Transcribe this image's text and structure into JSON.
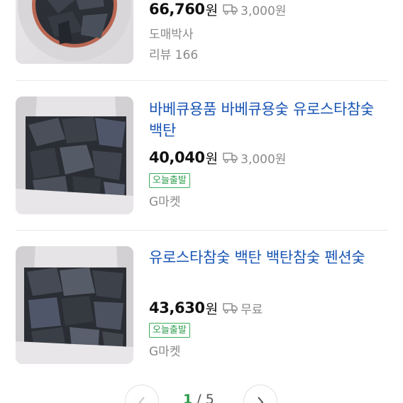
{
  "products": [
    {
      "title": "",
      "price": "66,760",
      "currency": "원",
      "shipping": "3,000원",
      "seller": "도매박사",
      "review": "리뷰 166"
    },
    {
      "title": "바베큐용품 바베큐용숯 유로스타참숯 백탄",
      "price": "40,040",
      "currency": "원",
      "shipping": "3,000원",
      "badge": "오늘출발",
      "seller": "G마켓"
    },
    {
      "title": "유로스타참숯 백탄 백탄참숯 펜션숯",
      "price": "43,630",
      "currency": "원",
      "shipping": "무료",
      "badge": "오늘출발",
      "seller": "G마켓"
    }
  ],
  "pagination": {
    "current": "1",
    "separator": "/",
    "total": "5"
  },
  "colors": {
    "title": "#1a56b4",
    "badge": "#2e9e4f",
    "muted": "#8a8a8a"
  },
  "icons": {
    "shipping": "truck-icon",
    "prev": "chevron-left-icon",
    "next": "chevron-right-icon"
  }
}
